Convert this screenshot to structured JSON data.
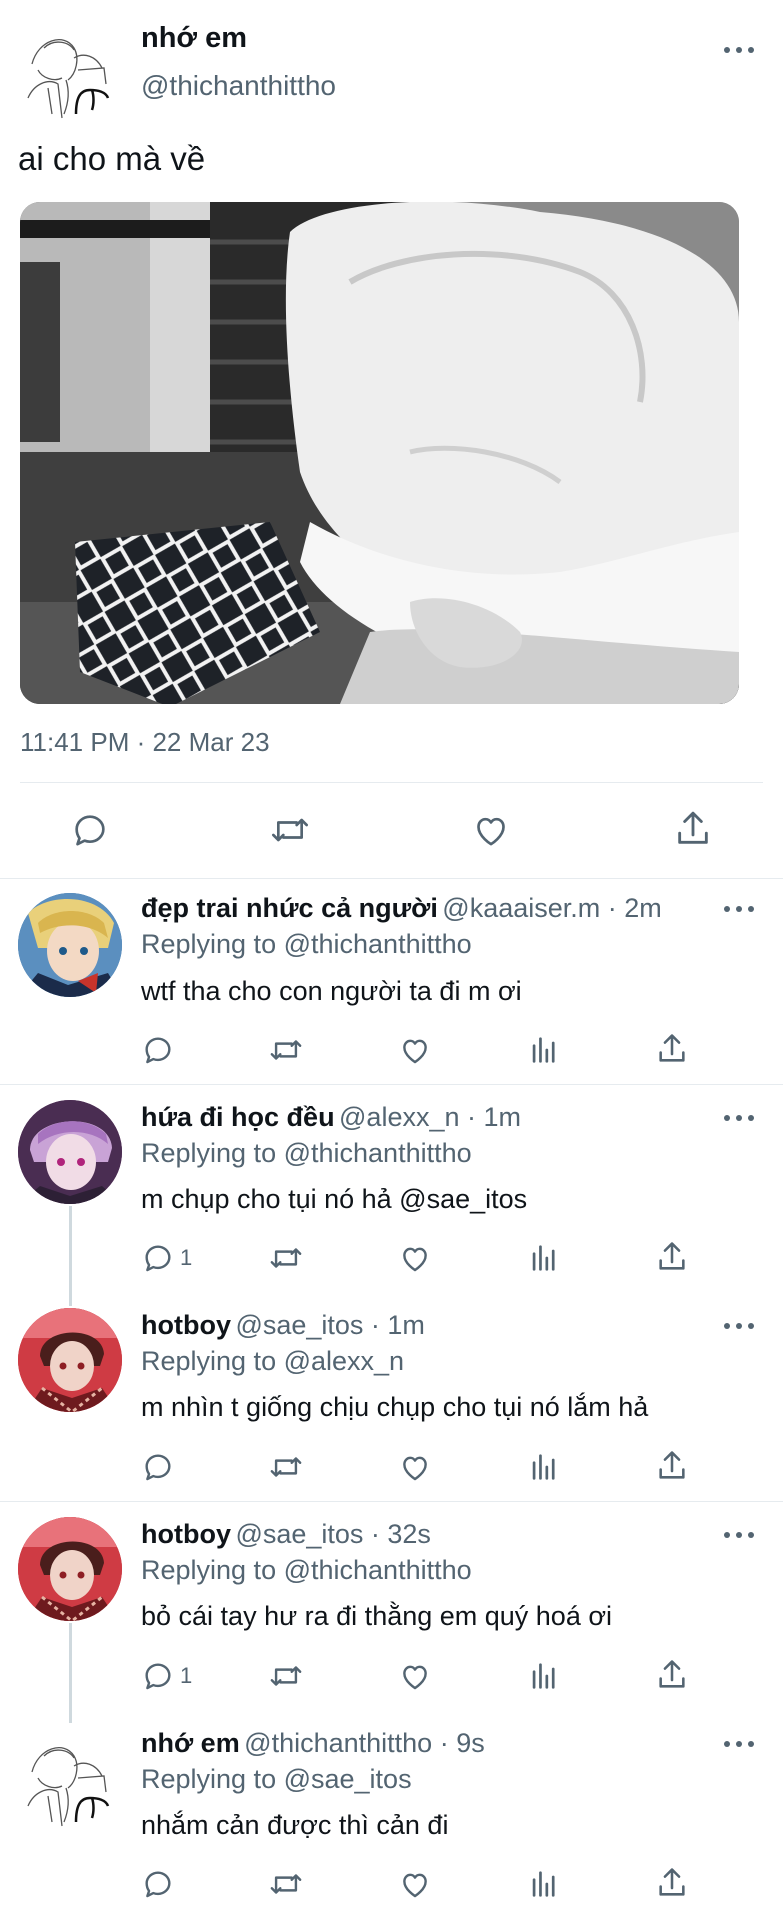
{
  "main_tweet": {
    "display_name": "nhớ em",
    "handle": "@thichanthittho",
    "text": "ai cho mà về",
    "timestamp": "11:41 PM · 22 Mar 23",
    "actions": [
      "reply-icon",
      "retweet-icon",
      "like-icon",
      "share-icon"
    ]
  },
  "replies": [
    {
      "display_name": "đẹp trai nhức cả người",
      "meta": "@kaaaiser.m · 2m",
      "replying_prefix": "Replying to ",
      "replying_to": "@thichanthittho",
      "text": "wtf tha cho con người ta đi m ơi",
      "text_mention": "",
      "reply_count": ""
    },
    {
      "display_name": "hứa đi học đều",
      "meta": "@alexx_n · 1m",
      "replying_prefix": "Replying to ",
      "replying_to": "@thichanthittho",
      "text": "m chụp cho tụi nó hả ",
      "text_mention": "@sae_itos",
      "reply_count": "1"
    },
    {
      "display_name": "hotboy",
      "meta": "@sae_itos · 1m",
      "replying_prefix": "Replying to ",
      "replying_to": "@alexx_n",
      "text": "m nhìn t giống chịu chụp cho tụi nó lắm hả",
      "text_mention": "",
      "reply_count": ""
    },
    {
      "display_name": "hotboy",
      "meta": "@sae_itos · 32s",
      "replying_prefix": "Replying to ",
      "replying_to": "@thichanthittho",
      "text": "bỏ cái tay hư ra đi thằng em quý hoá ơi",
      "text_mention": "",
      "reply_count": "1"
    },
    {
      "display_name": "nhớ em",
      "meta": "@thichanthittho · 9s",
      "replying_prefix": "Replying to ",
      "replying_to": "@sae_itos",
      "text": "nhắm cản được thì cản đi",
      "text_mention": "",
      "reply_count": ""
    }
  ],
  "colors": {
    "text": "#0f1419",
    "muted": "#536471",
    "link": "#1d9bf0",
    "divider": "#e6ebef"
  }
}
